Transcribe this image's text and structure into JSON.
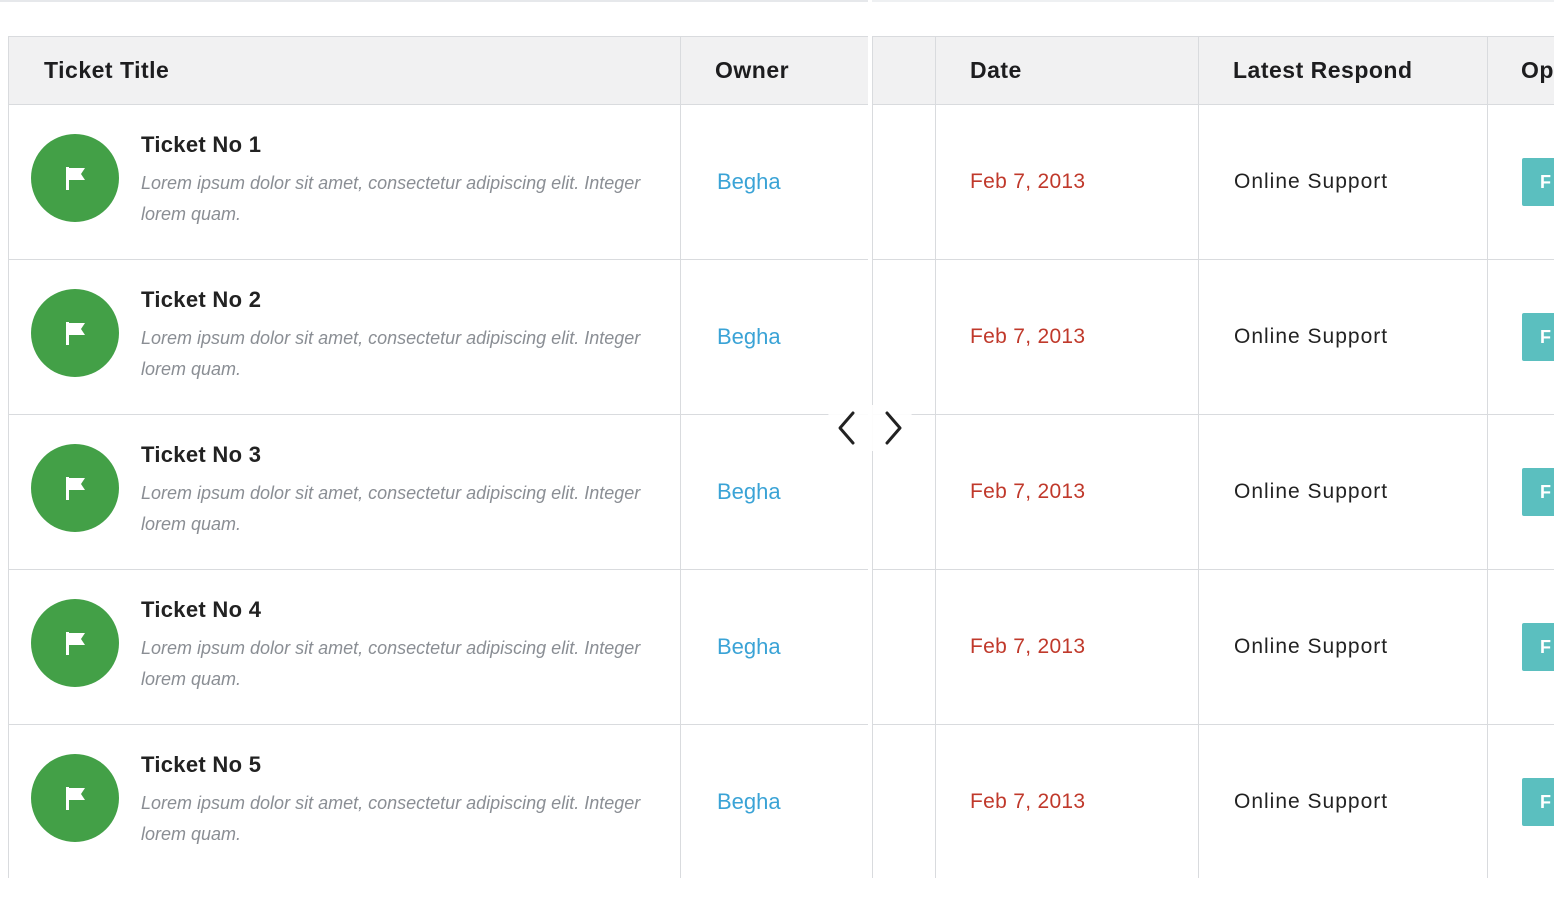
{
  "left_headers": {
    "title": "Ticket Title",
    "owner": "Owner"
  },
  "right_headers": {
    "date": "Date",
    "latest_respond": "Latest Respond",
    "operation": "Op"
  },
  "tickets": [
    {
      "title": "Ticket No 1",
      "description": "Lorem ipsum dolor sit amet, consectetur adipiscing elit. Integer lorem quam.",
      "owner": "Begha",
      "date": "Feb 7, 2013",
      "latest_respond": "Online Support",
      "op_label": "F"
    },
    {
      "title": "Ticket No 2",
      "description": "Lorem ipsum dolor sit amet, consectetur adipiscing elit. Integer lorem quam.",
      "owner": "Begha",
      "date": "Feb 7, 2013",
      "latest_respond": "Online Support",
      "op_label": "F"
    },
    {
      "title": "Ticket No 3",
      "description": "Lorem ipsum dolor sit amet, consectetur adipiscing elit. Integer lorem quam.",
      "owner": "Begha",
      "date": "Feb 7, 2013",
      "latest_respond": "Online Support",
      "op_label": "F"
    },
    {
      "title": "Ticket No 4",
      "description": "Lorem ipsum dolor sit amet, consectetur adipiscing elit. Integer lorem quam.",
      "owner": "Begha",
      "date": "Feb 7, 2013",
      "latest_respond": "Online Support",
      "op_label": "F"
    },
    {
      "title": "Ticket No 5",
      "description": "Lorem ipsum dolor sit amet, consectetur adipiscing elit. Integer lorem quam.",
      "owner": "Begha",
      "date": "Feb 7, 2013",
      "latest_respond": "Online Support",
      "op_label": "F"
    }
  ],
  "icons": {
    "ticket": "flag-icon",
    "prev": "chevron-left-icon",
    "next": "chevron-right-icon"
  },
  "colors": {
    "flag_circle": "#43a047",
    "owner_link": "#3aa3d6",
    "date": "#c0392b",
    "op_button": "#5bbfbf",
    "header_bg": "#f1f1f2"
  }
}
